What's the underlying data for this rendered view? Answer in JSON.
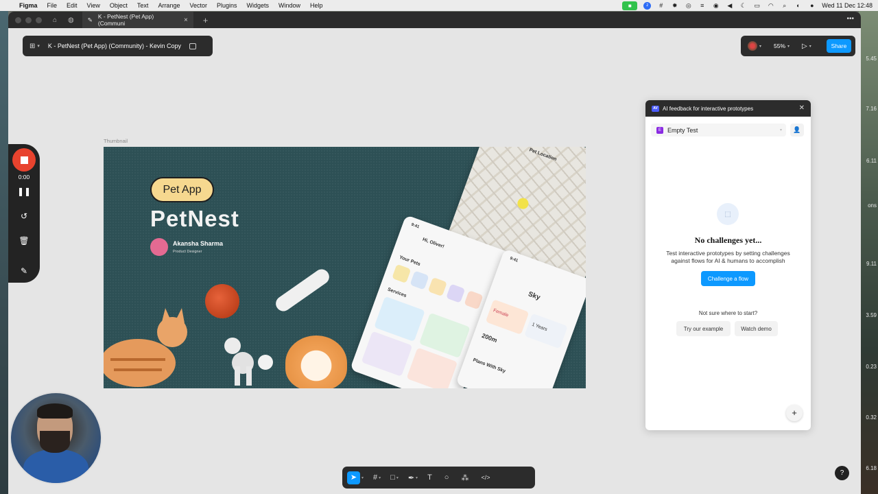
{
  "menubar": {
    "app": "Figma",
    "items": [
      "File",
      "Edit",
      "View",
      "Object",
      "Text",
      "Arrange",
      "Vector",
      "Plugins",
      "Widgets",
      "Window",
      "Help"
    ],
    "clock": "Wed 11 Dec  12:48"
  },
  "browser": {
    "tab_title": "K - PetNest (Pet App) (Communi"
  },
  "file": {
    "name": "K - PetNest (Pet App) (Community) - Kevin Copy"
  },
  "top_right": {
    "zoom": "55%",
    "share_label": "Share"
  },
  "frame": {
    "label": "Thumbnail",
    "pill": "Pet App",
    "brand": "PetNest",
    "author": "Akansha Sharma",
    "role": "Product Designer",
    "phone_map_title": "Pet Location",
    "phone_home_greet": "Hi, Oliver!",
    "phone_home_pets": "Your Pets",
    "phone_home_services": "Services",
    "phone_detail_name": "Sky",
    "phone_detail_gender": "Female",
    "phone_detail_age": "1 Years",
    "phone_detail_dist": "200m",
    "phone_detail_plans": "Plans With Sky",
    "time": "9:41"
  },
  "ai_panel": {
    "badge": "AV",
    "title": "AI feedback for interactive prototypes",
    "test_badge": "E",
    "test_name": "Empty Test",
    "empty_title": "No challenges yet...",
    "empty_desc": "Test interactive prototypes by setting challenges against flows for AI & humans to accomplish",
    "challenge_btn": "Challenge a flow",
    "not_sure": "Not sure where to start?",
    "try_example": "Try our example",
    "watch_demo": "Watch demo"
  },
  "recorder": {
    "time": "0:00"
  },
  "desktop_numbers": [
    "5.45",
    "7.16",
    "6.11",
    "ons",
    "9.11",
    "3.59",
    "0.23",
    "0.32",
    "6.18"
  ],
  "colors": {
    "accent": "#0d99ff",
    "record": "#e8432e",
    "dark_ui": "#2c2c2c"
  }
}
